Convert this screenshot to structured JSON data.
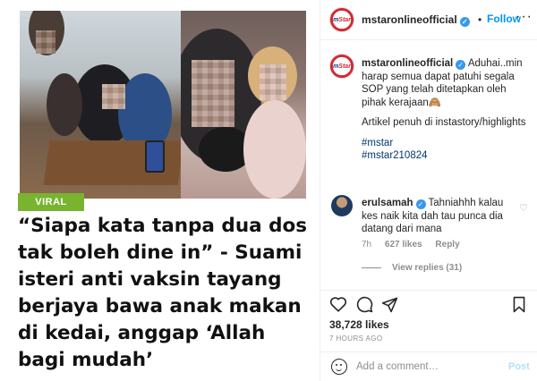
{
  "post": {
    "tag": "VIRAL",
    "headline": "“Siapa kata tanpa dua dos tak boleh dine in” - Suami isteri anti vaksin tayang berjaya bawa anak makan di kedai, anggap ‘Allah bagi mudah’"
  },
  "header": {
    "username": "mstaronlineofficial",
    "dot": "•",
    "follow_label": "Follow",
    "more": "···",
    "avatar_text_a": "m",
    "avatar_text_b": "Star"
  },
  "caption": {
    "username": "mstaronlineofficial",
    "text": "Aduhai..min harap semua dapat patuhi segala SOP yang telah ditetapkan oleh pihak kerajaan🙈",
    "text2": "Artikel penuh di instastory/highlights",
    "hashtags": [
      "#mstar",
      "#mstar210824"
    ]
  },
  "reply": {
    "username": "erulsamah",
    "text": "Tahniahhh kalau kes naik kita dah tau punca dia datang dari mana",
    "time": "7h",
    "likes": "627 likes",
    "reply_label": "Reply",
    "view_replies": "View replies (31)"
  },
  "stats": {
    "likes": "38,728 likes",
    "time_ago": "7 HOURS AGO"
  },
  "composer": {
    "placeholder": "Add a comment…",
    "post_label": "Post"
  },
  "colors": {
    "accent": "#0095f6",
    "verified": "#3897f0",
    "viral_tag": "#79b431",
    "post_disabled": "#b2dffc"
  },
  "icons": [
    "heart-icon",
    "comment-icon",
    "share-icon",
    "bookmark-icon",
    "emoji-icon",
    "more-options-icon",
    "verified-badge-icon"
  ]
}
